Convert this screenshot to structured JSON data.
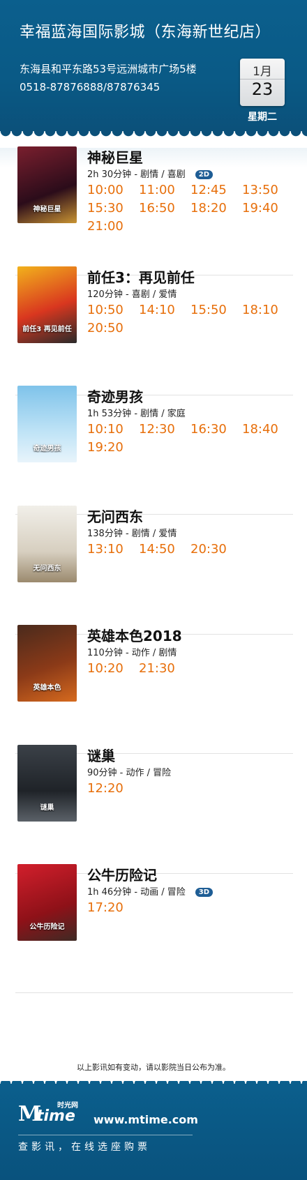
{
  "cinema": {
    "name": "幸福蓝海国际影城（东海新世纪店）",
    "address": "东海县和平东路53号远洲城市广场5楼",
    "phone": "0518-87876888/87876345"
  },
  "date": {
    "month": "1月",
    "day": "23",
    "weekday": "星期二"
  },
  "colors": {
    "header": "#0b5f8d",
    "showtime": "#e76f0b",
    "format_badge": "#1e5d95"
  },
  "movies": [
    {
      "title": "神秘巨星",
      "meta": "2h 30分钟 - 剧情 / 喜剧",
      "format": "2D",
      "poster_text": "神秘巨星",
      "times": [
        "10:00",
        "11:00",
        "12:45",
        "13:50",
        "15:30",
        "16:50",
        "18:20",
        "19:40",
        "21:00"
      ]
    },
    {
      "title": "前任3：再见前任",
      "meta": "120分钟 - 喜剧 / 爱情",
      "format": "",
      "poster_text": "前任3 再见前任",
      "times": [
        "10:50",
        "14:10",
        "15:50",
        "18:10",
        "20:50"
      ]
    },
    {
      "title": "奇迹男孩",
      "meta": "1h 53分钟 - 剧情 / 家庭",
      "format": "",
      "poster_text": "奇迹男孩",
      "times": [
        "10:10",
        "12:30",
        "16:30",
        "18:40",
        "19:20"
      ]
    },
    {
      "title": "无问西东",
      "meta": "138分钟 - 剧情 / 爱情",
      "format": "",
      "poster_text": "无问西东",
      "times": [
        "13:10",
        "14:50",
        "20:30"
      ]
    },
    {
      "title": "英雄本色2018",
      "meta": "110分钟 - 动作 / 剧情",
      "format": "",
      "poster_text": "英雄本色",
      "times": [
        "10:20",
        "21:30"
      ]
    },
    {
      "title": "谜巢",
      "meta": "90分钟 - 动作 / 冒险",
      "format": "",
      "poster_text": "谜巢",
      "times": [
        "12:20"
      ]
    },
    {
      "title": "公牛历险记",
      "meta": "1h 46分钟 - 动画 / 冒险",
      "format": "3D",
      "poster_text": "公牛历险记",
      "times": [
        "17:20"
      ]
    }
  ],
  "notice": "以上影讯如有变动，请以影院当日公布为准。",
  "footer": {
    "logo_m": "M",
    "logo_time": "time",
    "logo_cn": "时光网",
    "site": "www.mtime.com",
    "tagline": "查影讯，在线选座购票"
  }
}
